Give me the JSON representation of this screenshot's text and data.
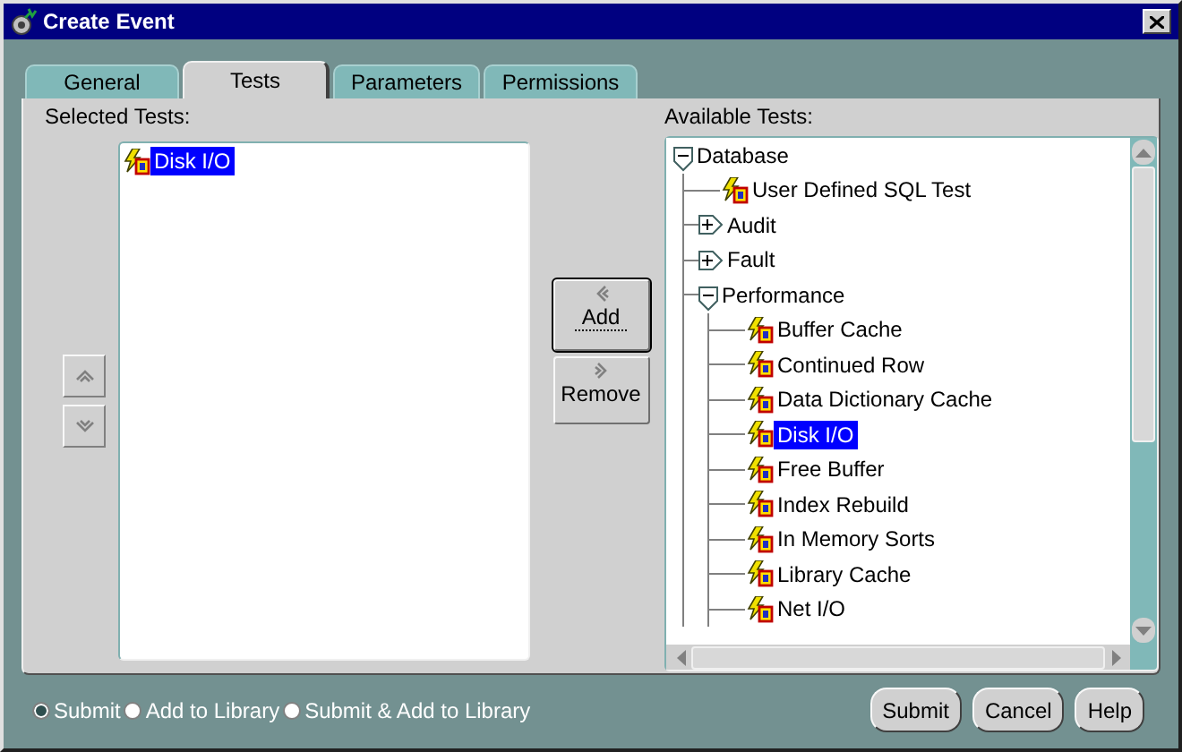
{
  "window": {
    "title": "Create Event"
  },
  "tabs": [
    {
      "label": "General",
      "selected": false
    },
    {
      "label": "Tests",
      "selected": true
    },
    {
      "label": "Parameters",
      "selected": false
    },
    {
      "label": "Permissions",
      "selected": false
    }
  ],
  "selected_tests": {
    "label": "Selected Tests:",
    "items": [
      {
        "label": "Disk I/O",
        "selected": true
      }
    ]
  },
  "move_buttons": {
    "add": "Add",
    "remove": "Remove"
  },
  "available_tests": {
    "label": "Available Tests:",
    "tree": [
      {
        "label": "Database",
        "kind": "folder",
        "expanded": true,
        "selected": false,
        "children": [
          {
            "label": "User Defined SQL Test",
            "kind": "test",
            "selected": false
          },
          {
            "label": "Audit",
            "kind": "folder",
            "expanded": false,
            "selected": false
          },
          {
            "label": "Fault",
            "kind": "folder",
            "expanded": false,
            "selected": false
          },
          {
            "label": "Performance",
            "kind": "folder",
            "expanded": true,
            "selected": false,
            "children": [
              {
                "label": "Buffer Cache",
                "kind": "test",
                "selected": false
              },
              {
                "label": "Continued Row",
                "kind": "test",
                "selected": false
              },
              {
                "label": "Data Dictionary Cache",
                "kind": "test",
                "selected": false
              },
              {
                "label": "Disk I/O",
                "kind": "test",
                "selected": true
              },
              {
                "label": "Free Buffer",
                "kind": "test",
                "selected": false
              },
              {
                "label": "Index Rebuild",
                "kind": "test",
                "selected": false
              },
              {
                "label": "In Memory Sorts",
                "kind": "test",
                "selected": false
              },
              {
                "label": "Library Cache",
                "kind": "test",
                "selected": false
              },
              {
                "label": "Net I/O",
                "kind": "test",
                "selected": false
              }
            ]
          }
        ]
      }
    ]
  },
  "submit_options": [
    {
      "label": "Submit",
      "selected": true
    },
    {
      "label": "Add to Library",
      "selected": false
    },
    {
      "label": "Submit & Add to Library",
      "selected": false
    }
  ],
  "buttons": [
    "Submit",
    "Cancel",
    "Help"
  ]
}
